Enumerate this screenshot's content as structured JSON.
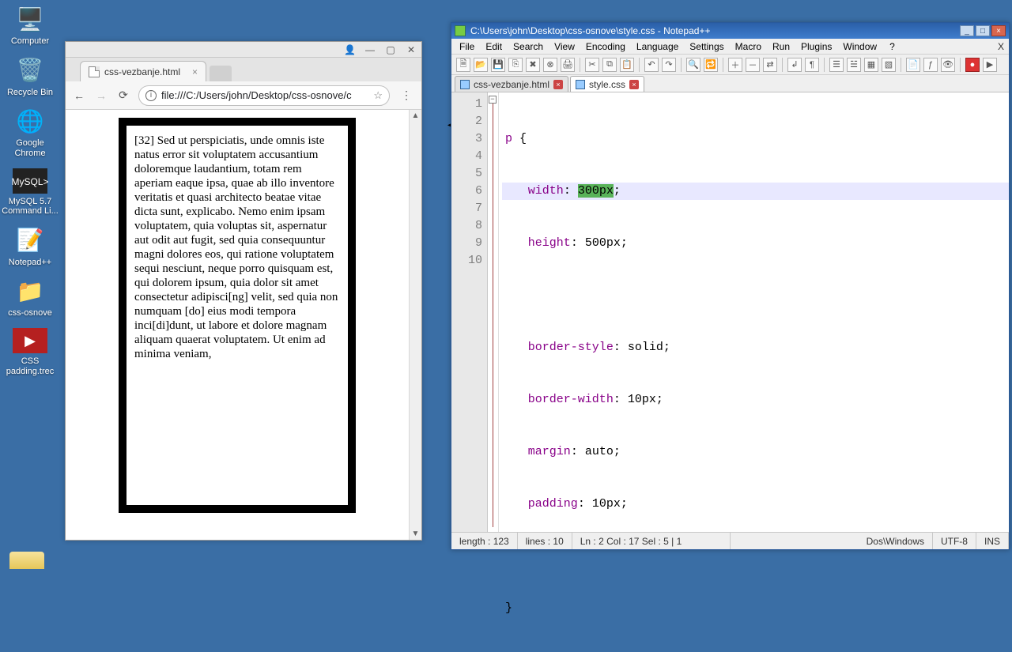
{
  "desktop": {
    "icons": [
      {
        "name": "computer",
        "glyph": "🖥️",
        "label": "Computer"
      },
      {
        "name": "recycle-bin",
        "glyph": "🗑️",
        "label": "Recycle Bin"
      },
      {
        "name": "chrome",
        "glyph": "🌐",
        "label": "Google Chrome"
      },
      {
        "name": "mysql-cli",
        "glyph": "◩",
        "label": "MySQL 5.7 Command Li..."
      },
      {
        "name": "notepadpp",
        "glyph": "📝",
        "label": "Notepad++"
      },
      {
        "name": "css-osnove",
        "glyph": "📁",
        "label": "css-osnove"
      },
      {
        "name": "css-padding",
        "glyph": "🎬",
        "label": "CSS padding.trec"
      }
    ]
  },
  "chrome": {
    "tab_title": "css-vezbanje.html",
    "url": "file:///C:/Users/john/Desktop/css-osnove/c",
    "page_text": "[32] Sed ut perspiciatis, unde omnis iste natus error sit voluptatem accusantium doloremque laudantium, totam rem aperiam eaque ipsa, quae ab illo inventore veritatis et quasi architecto beatae vitae dicta sunt, explicabo. Nemo enim ipsam voluptatem, quia voluptas sit, aspernatur aut odit aut fugit, sed quia consequuntur magni dolores eos, qui ratione voluptatem sequi nesciunt, neque porro quisquam est, qui dolorem ipsum, quia dolor sit amet consectetur adipisci[ng] velit, sed quia non numquam [do] eius modi tempora inci[di]dunt, ut labore et dolore magnam aliquam quaerat voluptatem. Ut enim ad minima veniam,"
  },
  "npp": {
    "title": "C:\\Users\\john\\Desktop\\css-osnove\\style.css - Notepad++",
    "menus": [
      "File",
      "Edit",
      "Search",
      "View",
      "Encoding",
      "Language",
      "Settings",
      "Macro",
      "Run",
      "Plugins",
      "Window",
      "?"
    ],
    "tabs": [
      {
        "label": "css-vezbanje.html",
        "active": false
      },
      {
        "label": "style.css",
        "active": true
      }
    ],
    "lines": {
      "l1_sel": "p",
      "l1_brace": " {",
      "l2_prop": "width",
      "l2_valA": "300px",
      "l2_end": ";",
      "l3_prop": "height",
      "l3_val": " 500px;",
      "l5_prop": "border-style",
      "l5_val": " solid;",
      "l6_prop": "border-width",
      "l6_val": " 10px;",
      "l7_prop": "margin",
      "l7_val": " auto;",
      "l8_prop": "padding",
      "l8_val": " 10px;",
      "l10": "}"
    },
    "gutter": [
      "1",
      "2",
      "3",
      "4",
      "5",
      "6",
      "7",
      "8",
      "9",
      "10"
    ],
    "status": {
      "length": "length : 123",
      "lines": "lines : 10",
      "pos": "Ln : 2   Col : 17   Sel : 5 | 1",
      "eol": "Dos\\Windows",
      "enc": "UTF-8",
      "mode": "INS"
    }
  }
}
